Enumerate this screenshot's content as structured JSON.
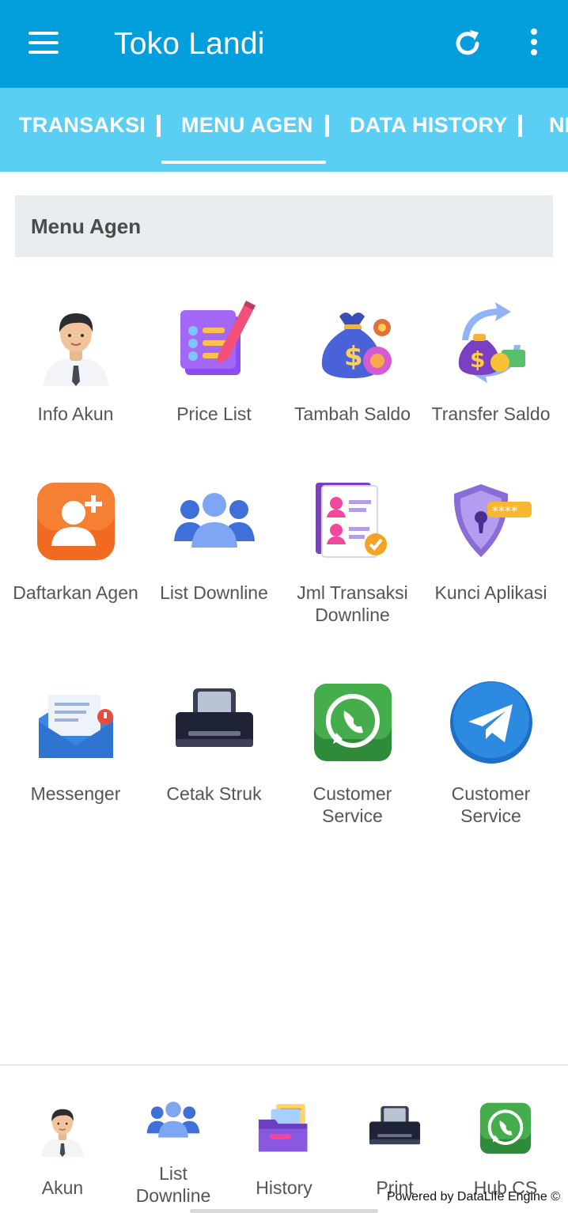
{
  "appbar": {
    "title": "Toko Landi",
    "menu_icon": "hamburger-menu-icon",
    "refresh_icon": "refresh-icon",
    "more_icon": "more-vert-icon"
  },
  "tabs": [
    {
      "label": "TRANSAKSI"
    },
    {
      "label": "MENU AGEN",
      "active": true
    },
    {
      "label": "DATA HISTORY"
    },
    {
      "label": "NE"
    }
  ],
  "section": {
    "title": "Menu Agen"
  },
  "menu": [
    {
      "label": "Info Akun",
      "icon": "person-icon"
    },
    {
      "label": "Price List",
      "icon": "checklist-icon"
    },
    {
      "label": "Tambah Saldo",
      "icon": "money-bag-icon"
    },
    {
      "label": "Transfer Saldo",
      "icon": "money-transfer-icon"
    },
    {
      "label": "Daftarkan Agen",
      "icon": "add-user-icon"
    },
    {
      "label": "List Downline",
      "icon": "people-group-icon"
    },
    {
      "label": "Jml Transaksi Downline",
      "icon": "document-icon"
    },
    {
      "label": "Kunci Aplikasi",
      "icon": "shield-lock-icon"
    },
    {
      "label": "Messenger",
      "icon": "envelope-icon"
    },
    {
      "label": "Cetak Struk",
      "icon": "printer-icon"
    },
    {
      "label": "Customer Service",
      "icon": "whatsapp-icon"
    },
    {
      "label": "Customer Service",
      "icon": "telegram-icon"
    }
  ],
  "bottom_nav": [
    {
      "label": "Akun",
      "icon": "person-icon"
    },
    {
      "label": "List Downline",
      "icon": "people-group-icon"
    },
    {
      "label": "History",
      "icon": "folder-icon"
    },
    {
      "label": "Print",
      "icon": "printer-icon"
    },
    {
      "label": "Hub CS",
      "icon": "whatsapp-icon"
    }
  ],
  "footer": {
    "powered_by": "Powered by DataLife Engine ©"
  },
  "colors": {
    "appbar": "#039fdc",
    "tabbar": "#5bcff3",
    "section_bg": "#e7ecee"
  }
}
